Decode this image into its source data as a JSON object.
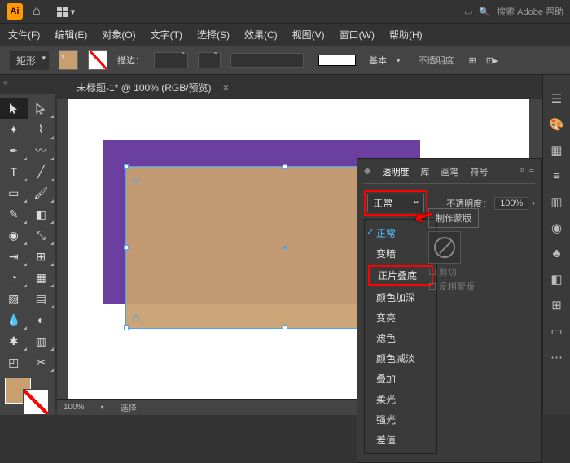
{
  "top": {
    "search_placeholder": "搜索 Adobe 帮助"
  },
  "menu": {
    "file": "文件(F)",
    "edit": "编辑(E)",
    "object": "对象(O)",
    "type": "文字(T)",
    "select": "选择(S)",
    "effect": "效果(C)",
    "view": "视图(V)",
    "window": "窗口(W)",
    "help": "帮助(H)"
  },
  "ctrl": {
    "shape": "矩形",
    "stroke_label": "描边：",
    "basic": "基本",
    "opacity_label": "不透明度"
  },
  "doc": {
    "title": "未标题-1* @ 100% (RGB/预览)"
  },
  "panel": {
    "tabs": {
      "opacity": "透明度",
      "lib": "库",
      "brush": "画笔",
      "symbol": "符号"
    },
    "blend_current": "正常",
    "opacity_label": "不透明度：",
    "opacity_value": "100%",
    "make_mask": "制作蒙版",
    "clip": "剪切",
    "invert": "反相蒙版"
  },
  "blend_modes": {
    "normal": "正常",
    "darken": "变暗",
    "multiply": "正片叠底",
    "color_burn": "颜色加深",
    "lighten": "变亮",
    "screen": "滤色",
    "color_dodge": "颜色减淡",
    "overlay": "叠加",
    "soft_light": "柔光",
    "hard_light": "强光",
    "difference": "差值"
  },
  "status": {
    "zoom": "100%",
    "sel_left": "选择",
    "sel_right": "选择"
  },
  "colors": {
    "tan": "#c8a070",
    "purple": "#6b3fa0",
    "red": "#ff0000"
  }
}
